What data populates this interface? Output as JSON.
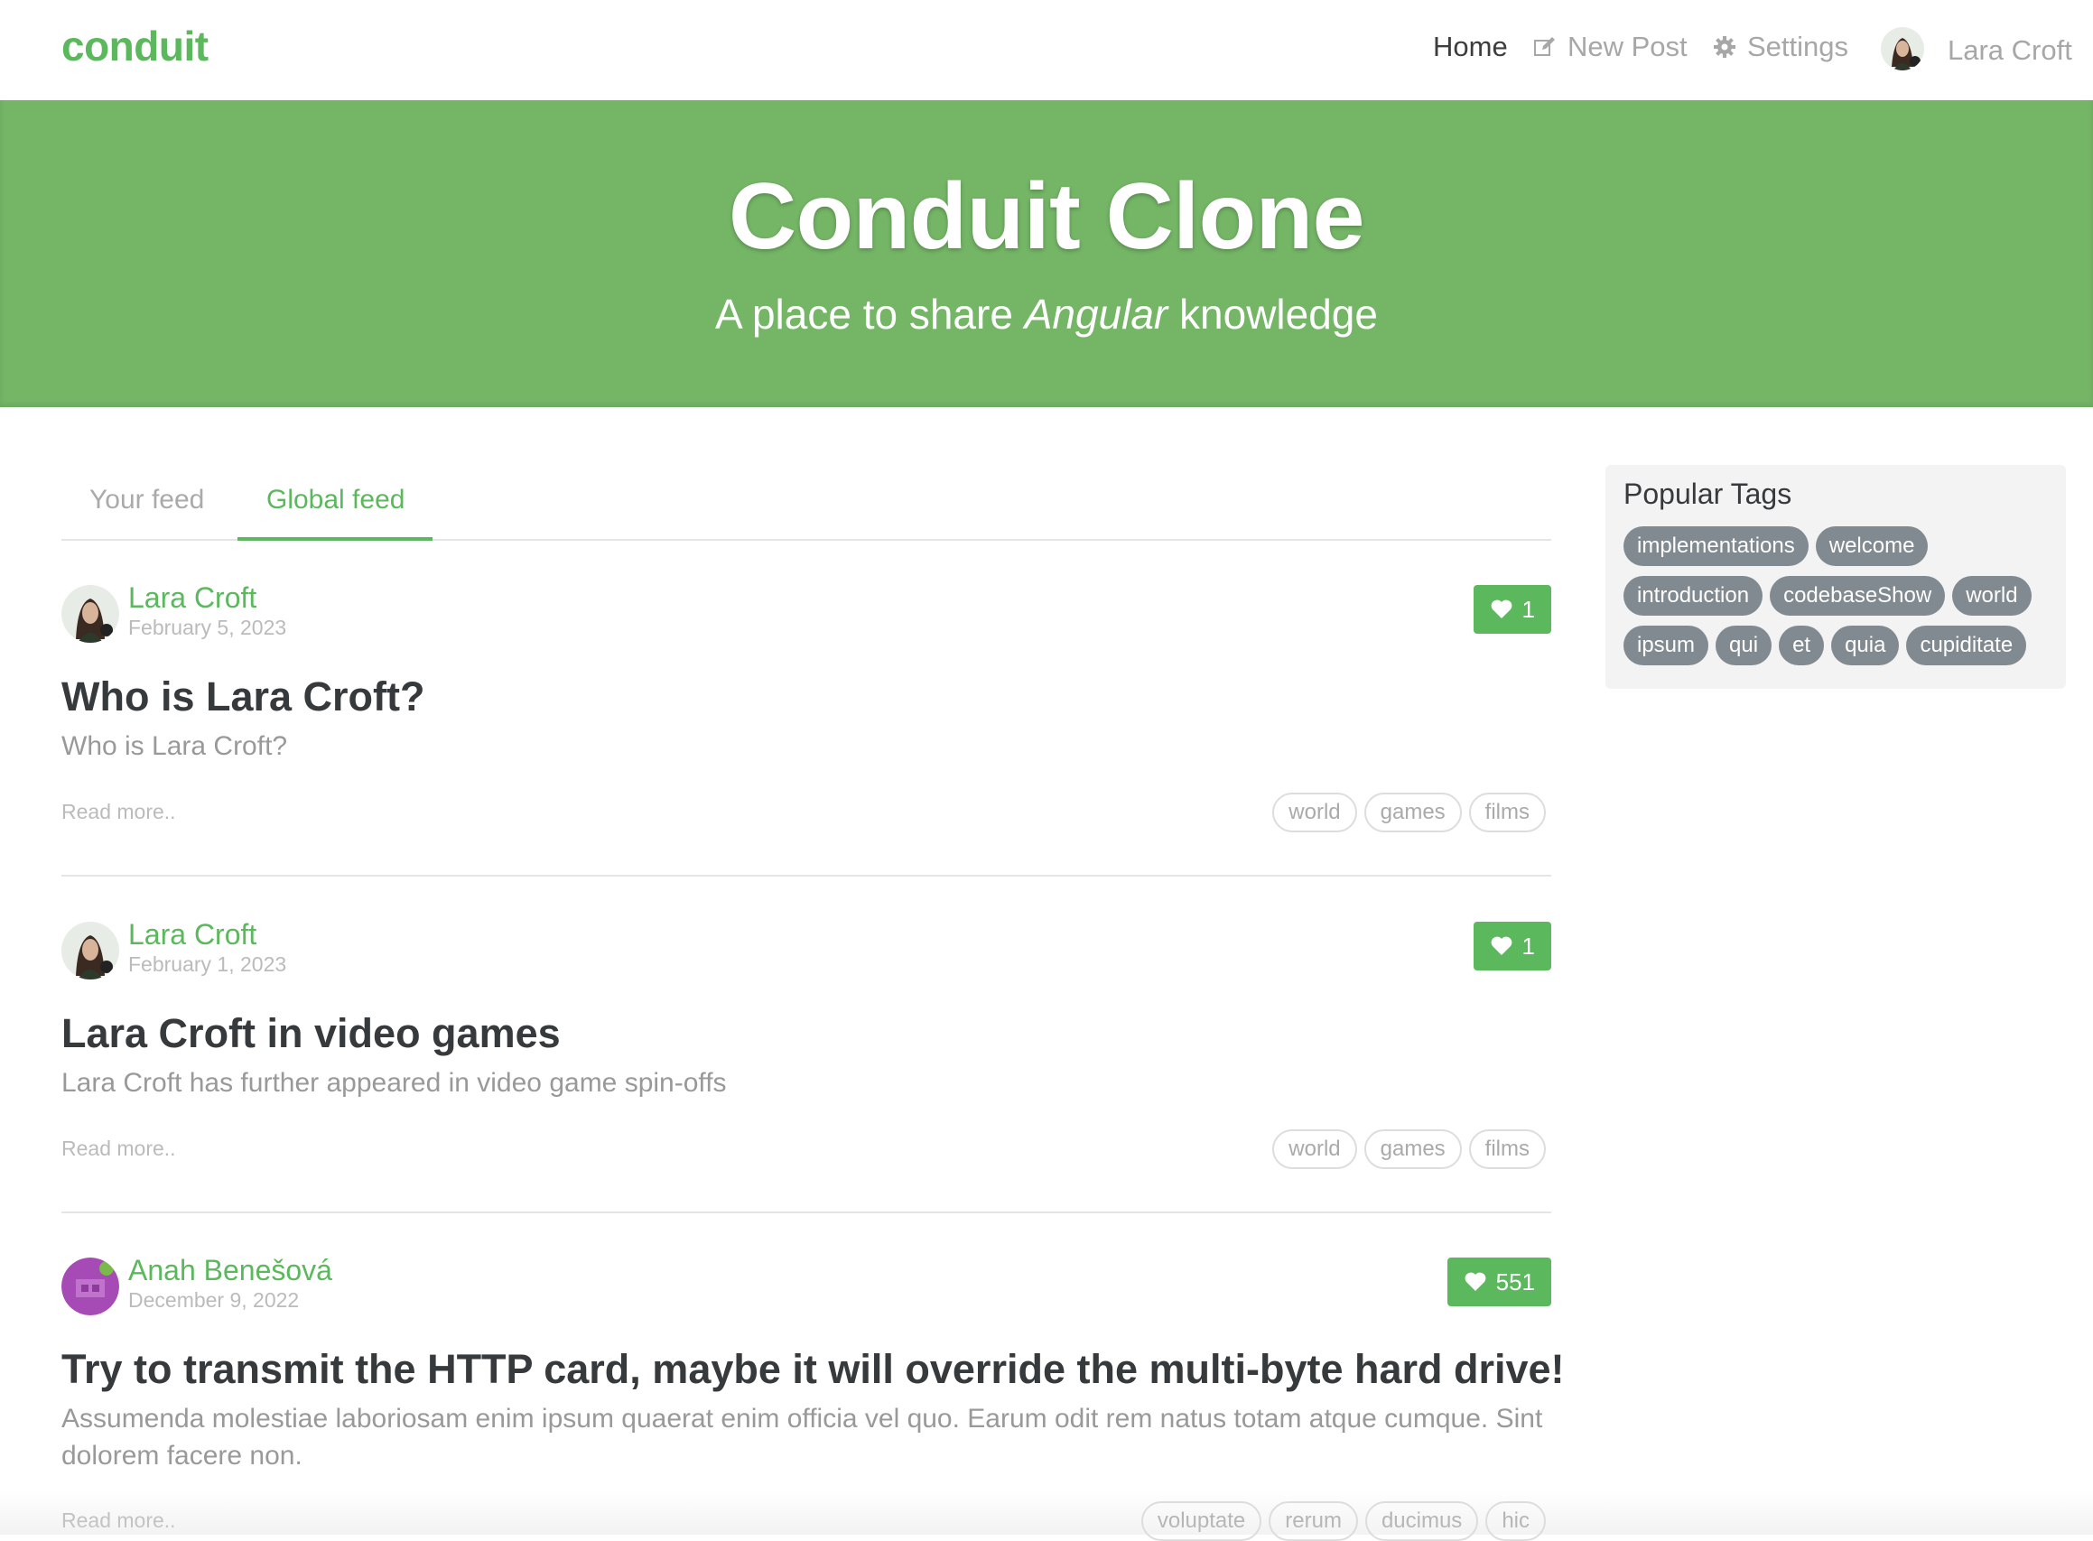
{
  "nav": {
    "brand": "conduit",
    "home": "Home",
    "new_post": "New Post",
    "settings": "Settings",
    "user": "Lara Croft"
  },
  "banner": {
    "title": "Conduit Clone",
    "subtitle_pre": "A place to share ",
    "subtitle_em": "Angular",
    "subtitle_post": " knowledge"
  },
  "tabs": {
    "your_feed": "Your feed",
    "global_feed": "Global feed"
  },
  "articles": [
    {
      "author": "Lara Croft",
      "date": "February 5, 2023",
      "likes": "1",
      "title": "Who is Lara Croft?",
      "description": "Who is Lara Croft?",
      "read_more": "Read more..",
      "tags": [
        "world",
        "games",
        "films"
      ]
    },
    {
      "author": "Lara Croft",
      "date": "February 1, 2023",
      "likes": "1",
      "title": "Lara Croft in video games",
      "description": "Lara Croft has further appeared in video game spin-offs",
      "read_more": "Read more..",
      "tags": [
        "world",
        "games",
        "films"
      ]
    },
    {
      "author": "Anah Benešová",
      "date": "December 9, 2022",
      "likes": "551",
      "title": "Try to transmit the HTTP card, maybe it will override the multi-byte hard drive!",
      "description": "Assumenda molestiae laboriosam enim ipsum quaerat enim officia vel quo. Earum odit rem natus totam atque cumque. Sint dolorem facere non.",
      "read_more": "Read more..",
      "tags": [
        "voluptate",
        "rerum",
        "ducimus",
        "hic"
      ]
    }
  ],
  "sidebar": {
    "title": "Popular Tags",
    "tags": [
      "implementations",
      "welcome",
      "introduction",
      "codebaseShow",
      "world",
      "ipsum",
      "qui",
      "et",
      "quia",
      "cupiditate"
    ]
  },
  "colors": {
    "brand_green": "#5cb85c",
    "banner_green": "#74b566",
    "tag_gray": "#818a91"
  },
  "icons": {
    "new_post": "edit-icon",
    "settings": "gear-icon",
    "like": "heart-icon"
  }
}
